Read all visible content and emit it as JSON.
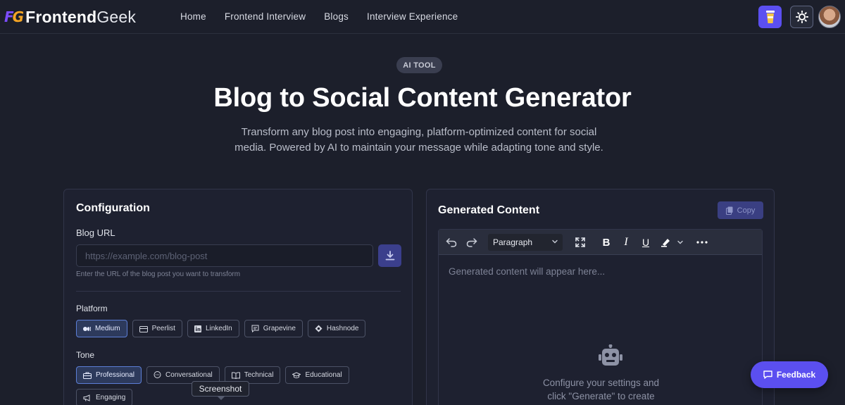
{
  "nav": {
    "logo_mark_1": "F",
    "logo_mark_2": "G",
    "logo_bold": "Frontend",
    "logo_light": "Geek",
    "links": [
      "Home",
      "Frontend Interview",
      "Blogs",
      "Interview Experience"
    ]
  },
  "hero": {
    "badge": "AI TOOL",
    "title": "Blog to Social Content Generator",
    "description": "Transform any blog post into engaging, platform-optimized content for social media. Powered by AI to maintain your message while adapting tone and style."
  },
  "config": {
    "title": "Configuration",
    "blog_url_label": "Blog URL",
    "url_placeholder": "https://example.com/blog-post",
    "url_value": "",
    "url_hint": "Enter the URL of the blog post you want to transform",
    "platform_label": "Platform",
    "platforms": [
      {
        "label": "Medium",
        "icon": "medium-icon",
        "active": true
      },
      {
        "label": "Peerlist",
        "icon": "peerlist-icon",
        "active": false
      },
      {
        "label": "LinkedIn",
        "icon": "linkedin-icon",
        "active": false
      },
      {
        "label": "Grapevine",
        "icon": "grapevine-icon",
        "active": false
      },
      {
        "label": "Hashnode",
        "icon": "hashnode-icon",
        "active": false
      }
    ],
    "tone_label": "Tone",
    "tones": [
      {
        "label": "Professional",
        "icon": "briefcase-icon",
        "active": true
      },
      {
        "label": "Conversational",
        "icon": "chat-icon",
        "active": false
      },
      {
        "label": "Technical",
        "icon": "book-icon",
        "active": false
      },
      {
        "label": "Educational",
        "icon": "graduation-cap-icon",
        "active": false
      },
      {
        "label": "Engaging",
        "icon": "megaphone-icon",
        "active": false
      }
    ],
    "tooltip": "Screenshot"
  },
  "output": {
    "title": "Generated Content",
    "copy_label": "Copy",
    "format_select": "Paragraph",
    "placeholder": "Generated content will appear here...",
    "empty_line1": "Configure your settings and",
    "empty_line2": "click \"Generate\" to create"
  },
  "feedback_label": "Feedback",
  "colors": {
    "background": "#1c1f2b",
    "accent": "#5b4ff0",
    "active_chip": "#2d3a5c",
    "active_chip_border": "#5c7ed6"
  }
}
